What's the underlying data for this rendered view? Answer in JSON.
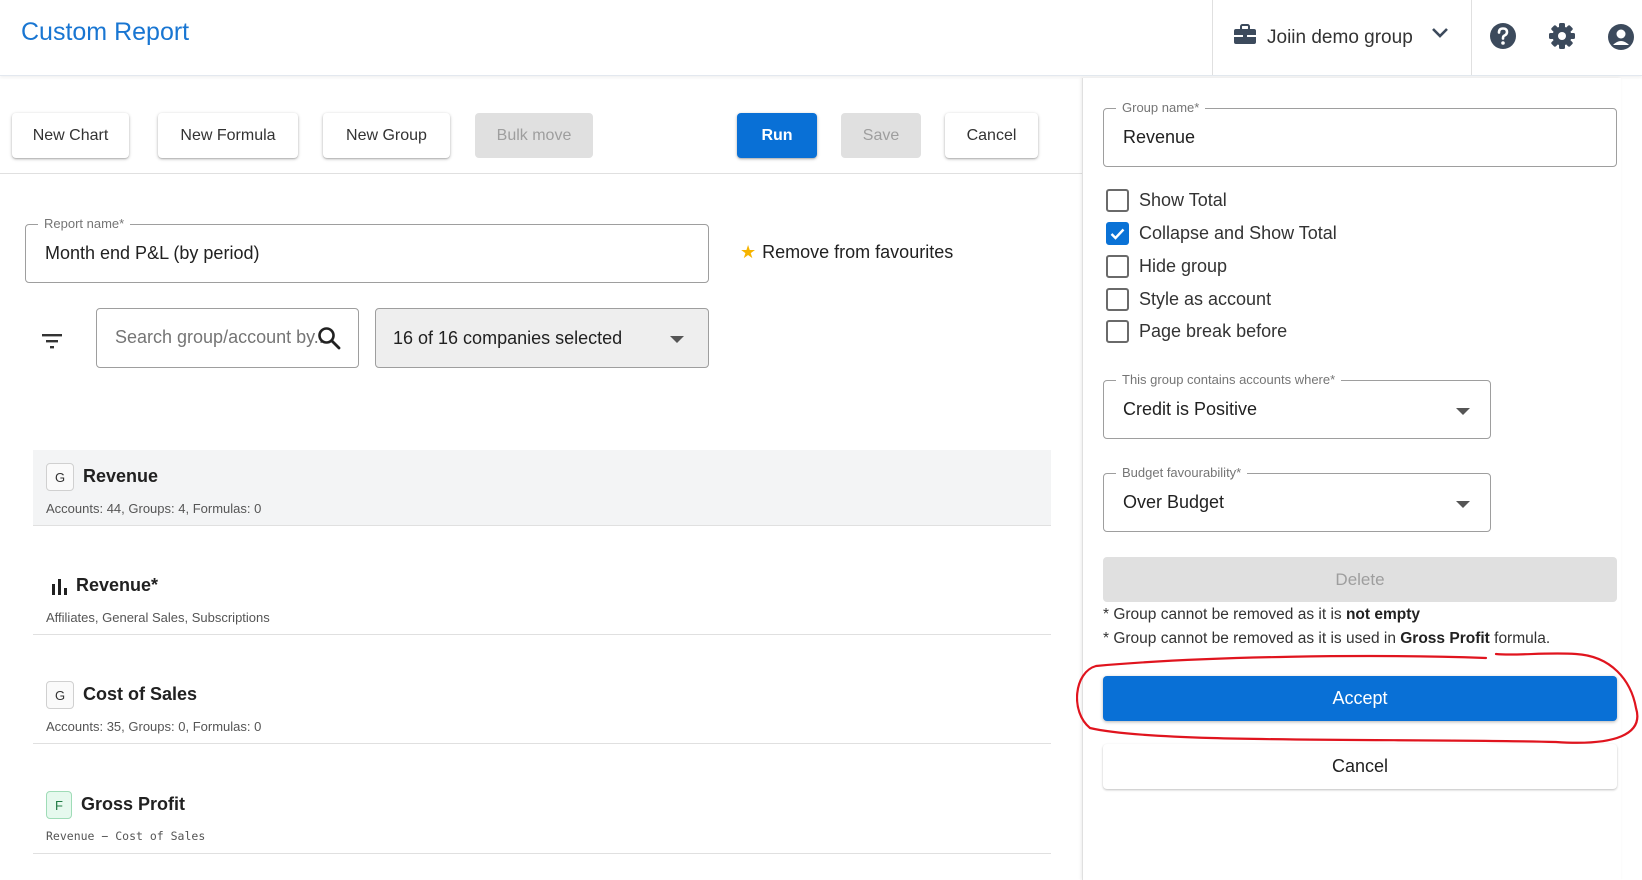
{
  "header": {
    "title": "Custom Report",
    "group_selector": "Joiin demo group",
    "accent_color": "#1976d2"
  },
  "toolbar": {
    "new_chart": "New Chart",
    "new_formula": "New Formula",
    "new_group": "New Group",
    "bulk_move": "Bulk move",
    "run": "Run",
    "save": "Save",
    "cancel": "Cancel"
  },
  "report": {
    "name_label": "Report name*",
    "name_value": "Month end P&L (by period)",
    "favourite": "Remove from favourites"
  },
  "filters": {
    "search_placeholder": "Search group/account by...",
    "companies": "16 of 16 companies selected"
  },
  "rows": [
    {
      "badge": "G",
      "title": "Revenue",
      "subtitle": "Accounts: 44, Groups: 4, Formulas: 0"
    },
    {
      "badge": "chart-icon",
      "title": "Revenue*",
      "subtitle": "Affiliates, General Sales, Subscriptions"
    },
    {
      "badge": "G",
      "title": "Cost of Sales",
      "subtitle": "Accounts: 35, Groups: 0, Formulas: 0"
    },
    {
      "badge": "F",
      "title": "Gross Profit",
      "subtitle": "Revenue − Cost of Sales"
    }
  ],
  "panel": {
    "group_name_label": "Group name*",
    "group_name_value": "Revenue",
    "options": [
      {
        "label": "Show Total",
        "checked": false
      },
      {
        "label": "Collapse and Show Total",
        "checked": true
      },
      {
        "label": "Hide group",
        "checked": false
      },
      {
        "label": "Style as account",
        "checked": false
      },
      {
        "label": "Page break before",
        "checked": false
      }
    ],
    "contains_label": "This group contains accounts where*",
    "contains_value": "Credit is Positive",
    "budget_label": "Budget favourability*",
    "budget_value": "Over Budget",
    "delete": "Delete",
    "note1_prefix": "* Group cannot be removed as it is ",
    "note1_bold": "not empty",
    "note2_prefix": "* Group cannot be removed as it is used in ",
    "note2_bold": "Gross Profit",
    "note2_suffix": " formula.",
    "accept": "Accept",
    "cancel": "Cancel",
    "primary_color": "#0970d6",
    "annotation_color": "#e0141e"
  }
}
